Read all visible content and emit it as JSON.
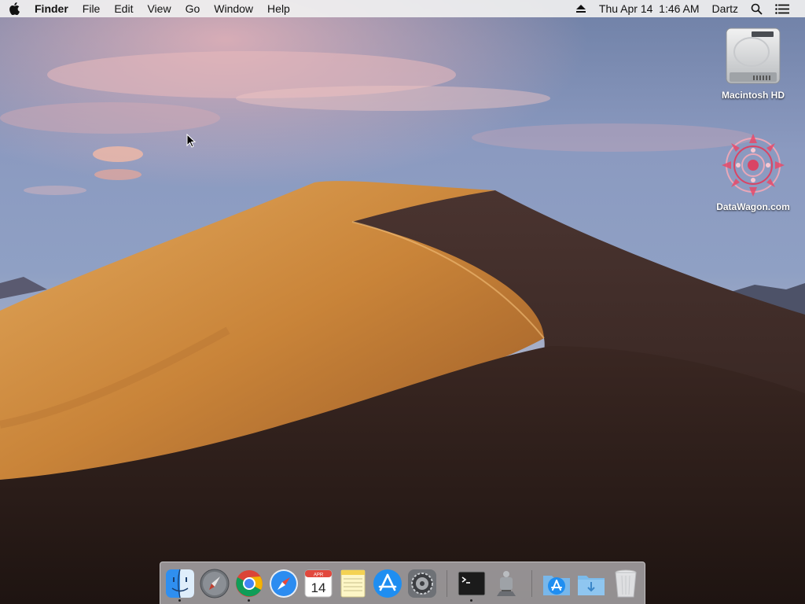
{
  "menubar": {
    "apple_icon": "apple-logo-icon",
    "app_name": "Finder",
    "menus": [
      "File",
      "Edit",
      "View",
      "Go",
      "Window",
      "Help"
    ],
    "status": {
      "eject_icon": "eject-icon",
      "datetime": "Thu Apr 14  1:46 AM",
      "user": "Dartz",
      "search_icon": "spotlight-search-icon",
      "notifications_icon": "notification-center-icon"
    }
  },
  "desktop": {
    "icons": [
      {
        "label": "Macintosh HD",
        "icon": "hard-drive-icon"
      },
      {
        "label": "DataWagon.com",
        "icon": "mandala-image-icon"
      }
    ]
  },
  "dock": {
    "items": [
      {
        "name": "Finder",
        "icon": "finder-icon",
        "running": true
      },
      {
        "name": "Launchpad",
        "icon": "launchpad-icon",
        "running": false
      },
      {
        "name": "Google Chrome",
        "icon": "chrome-icon",
        "running": true
      },
      {
        "name": "Safari",
        "icon": "safari-icon",
        "running": false
      },
      {
        "name": "Calendar",
        "icon": "calendar-icon",
        "running": false,
        "month": "APR",
        "day": "14"
      },
      {
        "name": "Notes",
        "icon": "notes-icon",
        "running": false
      },
      {
        "name": "App Store",
        "icon": "app-store-icon",
        "running": false
      },
      {
        "name": "System Preferences",
        "icon": "system-preferences-icon",
        "running": false
      },
      {
        "name": "Terminal",
        "icon": "terminal-icon",
        "running": true
      },
      {
        "name": "Automator",
        "icon": "automator-icon",
        "running": false
      },
      {
        "name": "Applications",
        "icon": "applications-folder-icon",
        "running": false
      },
      {
        "name": "Downloads",
        "icon": "downloads-folder-icon",
        "running": false
      },
      {
        "name": "Trash",
        "icon": "trash-icon",
        "running": false
      }
    ]
  },
  "colors": {
    "menubar_bg": "#f0f0f0",
    "sky_top": "#7d8fb0",
    "dune_light": "#d99a4e",
    "dune_shadow": "#3a2620"
  }
}
